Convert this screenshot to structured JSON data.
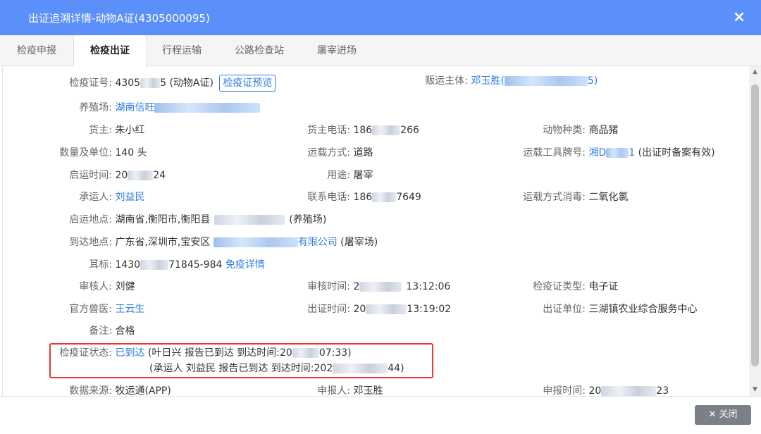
{
  "dialog": {
    "title": "出证追溯详情-动物A证(4305000095)",
    "close_icon": "×"
  },
  "tabs": [
    {
      "label": "检疫申报"
    },
    {
      "label": "检疫出证"
    },
    {
      "label": "行程运输"
    },
    {
      "label": "公路检查站"
    },
    {
      "label": "屠宰进场"
    }
  ],
  "fields": {
    "cert_no": {
      "label": "检疫证号:",
      "prefix": "4305",
      "suffix": "5 (动物A证)"
    },
    "preview_button": "检疫证预览",
    "trader": {
      "label": "贩运主体:",
      "prefix": "邓玉胜(",
      "suffix": "5)"
    },
    "farm": {
      "label": "养殖场:",
      "prefix": "湖南信旺"
    },
    "owner": {
      "label": "货主:",
      "value": "朱小红"
    },
    "owner_phone": {
      "label": "货主电话:",
      "prefix": "186",
      "suffix": "266"
    },
    "animal_type": {
      "label": "动物种类:",
      "value": "商品猪"
    },
    "quantity": {
      "label": "数量及单位:",
      "value": "140 头"
    },
    "transport_mode": {
      "label": "运载方式:",
      "value": "道路"
    },
    "plate_no": {
      "label": "运载工具牌号:",
      "prefix": "湘D",
      "suffix": "1",
      "note": " (出证时备案有效)"
    },
    "departure_time": {
      "label": "启运时间:",
      "prefix": "20",
      "suffix": "24"
    },
    "usage": {
      "label": "用途:",
      "value": "屠宰"
    },
    "carrier": {
      "label": "承运人:",
      "value": "刘益民"
    },
    "contact_phone": {
      "label": "联系电话:",
      "prefix": "186",
      "suffix": "7649"
    },
    "disinfection": {
      "label": "运载方式消毒:",
      "value": "二氧化氯"
    },
    "departure_place": {
      "label": "启运地点:",
      "prefix": "湖南省,衡阳市,衡阳县",
      "suffix": "(养殖场)"
    },
    "arrival_place": {
      "label": "到达地点:",
      "prefix": "广东省,深圳市,宝安区",
      "link_suffix": "有限公司",
      "suffix": "(屠宰场)"
    },
    "ear_tag": {
      "label": "耳标:",
      "prefix": "1430",
      "suffix": "71845-984",
      "link": "免疫详情"
    },
    "reviewer": {
      "label": "审核人:",
      "value": "刘健"
    },
    "review_time": {
      "label": "审核时间:",
      "prefix": "2",
      "suffix": "13:12:06"
    },
    "cert_type": {
      "label": "检疫证类型:",
      "value": "电子证"
    },
    "vet": {
      "label": "官方兽医:",
      "value": "王云生"
    },
    "issue_time": {
      "label": "出证时间:",
      "prefix": "20",
      "suffix": "13:19:02"
    },
    "issuing_unit": {
      "label": "出证单位:",
      "value": "三湖镇农业综合服务中心"
    },
    "remark": {
      "label": "备注:",
      "value": "合格"
    },
    "status": {
      "label": "检疫证状态:",
      "value": "已到达",
      "line1_prefix": "(叶日兴 报告已到达     到达时间:20",
      "line1_suffix": "07:33)",
      "line2_prefix": "(承运人 刘益民 报告已到达     到达时间:202",
      "line2_suffix": "44)"
    },
    "data_source": {
      "label": "数据来源:",
      "value": "牧运通(APP)"
    },
    "applicant": {
      "label": "申报人:",
      "value": "邓玉胜"
    },
    "apply_time": {
      "label": "申报时间:",
      "prefix": "20",
      "suffix": "23"
    }
  },
  "footer": {
    "close_label": "✕ 关闭"
  },
  "colors": {
    "header": "#5b8ff9",
    "link": "#2f7de1",
    "highlight_border": "#e53935"
  }
}
